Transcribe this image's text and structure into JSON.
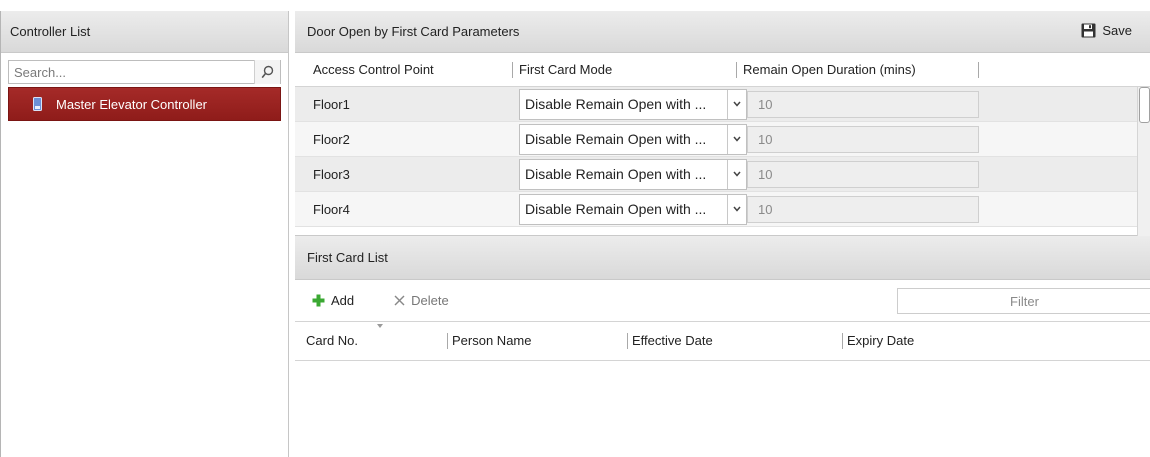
{
  "left_panel": {
    "title": "Controller List",
    "search_placeholder": "Search...",
    "tree": [
      {
        "label": "Master Elevator Controller",
        "selected": true
      }
    ]
  },
  "params_panel": {
    "title": "Door Open by First Card Parameters",
    "save_label": "Save",
    "columns": [
      "Access Control Point",
      "First Card Mode",
      "Remain Open Duration (mins)"
    ],
    "rows": [
      {
        "point": "Floor1",
        "mode": "Disable Remain Open with ...",
        "duration": "10"
      },
      {
        "point": "Floor2",
        "mode": "Disable Remain Open with ...",
        "duration": "10"
      },
      {
        "point": "Floor3",
        "mode": "Disable Remain Open with ...",
        "duration": "10"
      },
      {
        "point": "Floor4",
        "mode": "Disable Remain Open with ...",
        "duration": "10"
      }
    ]
  },
  "first_card_list": {
    "title": "First Card List",
    "add_label": "Add",
    "delete_label": "Delete",
    "filter_placeholder": "Filter",
    "columns": [
      "Card No.",
      "Person Name",
      "Effective Date",
      "Expiry Date"
    ]
  },
  "colors": {
    "selected_bg": "#9b2422",
    "header_bg": "#e3e3e3",
    "add_icon": "#3aa832"
  },
  "icons": {
    "search": "search-icon",
    "save": "floppy-disk-icon",
    "add": "plus-icon",
    "delete": "x-icon",
    "dropdown": "chevron-down-icon",
    "device": "elevator-controller-icon"
  }
}
